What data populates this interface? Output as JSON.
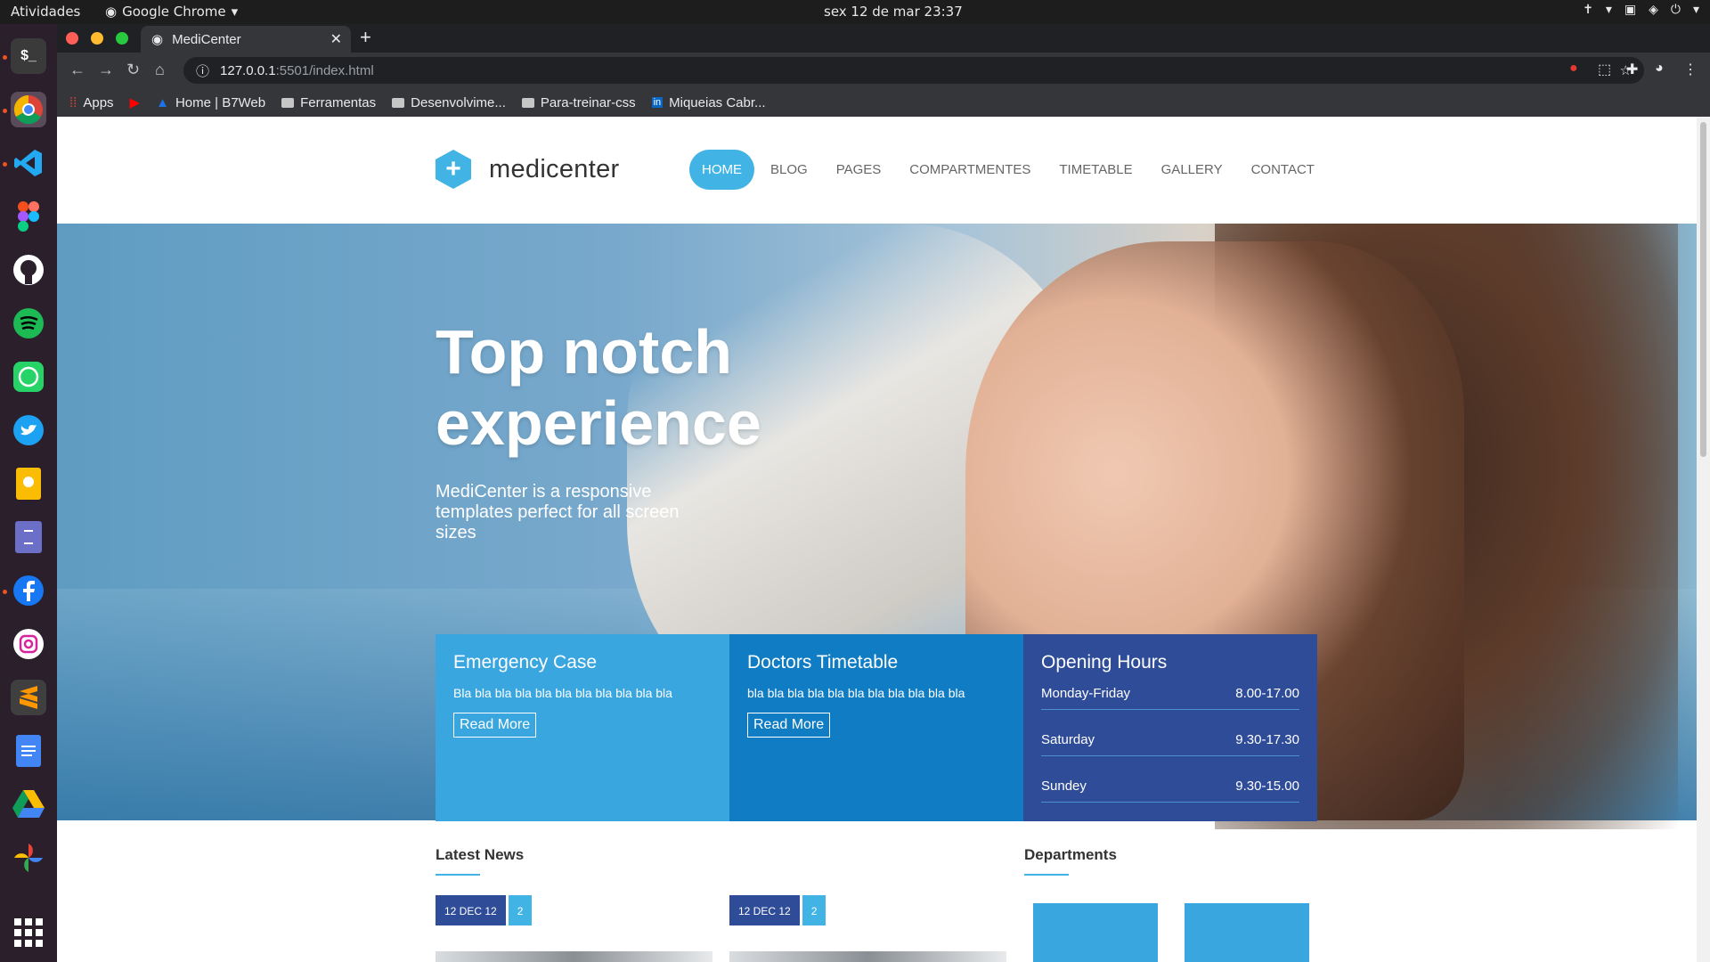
{
  "system": {
    "activities": "Atividades",
    "app_name": "Google Chrome",
    "clock": "sex 12 de mar  23:37"
  },
  "browser": {
    "tab_title": "MediCenter",
    "url_host": "127.0.0.1",
    "url_path": ":5501/index.html",
    "bookmarks": [
      {
        "label": "Apps",
        "icon": "apps-grid-icon"
      },
      {
        "label": "",
        "icon": "youtube-icon"
      },
      {
        "label": "Home | B7Web",
        "icon": "b7web-icon"
      },
      {
        "label": "Ferramentas",
        "icon": "folder-icon"
      },
      {
        "label": "Desenvolvime...",
        "icon": "folder-icon"
      },
      {
        "label": "Para-treinar-css",
        "icon": "folder-icon"
      },
      {
        "label": "Miqueias Cabr...",
        "icon": "linkedin-icon"
      }
    ]
  },
  "site": {
    "logo_text": "medicenter",
    "nav": [
      "HOME",
      "BLOG",
      "PAGES",
      "COMPARTMENTES",
      "TIMETABLE",
      "GALLERY",
      "CONTACT"
    ],
    "hero_title": "Top notch experience",
    "hero_lead": "MediCenter is a responsive templates perfect for all screen sizes",
    "cards": {
      "emergency": {
        "title": "Emergency Case",
        "text": "Bla bla bla bla bla bla bla bla bla bla bla",
        "button": "Read More"
      },
      "doctors": {
        "title": "Doctors Timetable",
        "text": "bla bla bla bla bla bla bla bla bla bla bla",
        "button": "Read More"
      },
      "hours": {
        "title": "Opening Hours",
        "rows": [
          {
            "day": "Monday-Friday",
            "time": "8.00-17.00"
          },
          {
            "day": "Saturday",
            "time": "9.30-17.30"
          },
          {
            "day": "Sundey",
            "time": "9.30-15.00"
          }
        ]
      }
    },
    "latest_news": "Latest News",
    "news": [
      {
        "date": "12 DEC 12",
        "comments": "2"
      },
      {
        "date": "12 DEC 12",
        "comments": "2"
      }
    ],
    "departments": "Departments"
  },
  "colors": {
    "accent": "#42b3e5",
    "card1": "#3aa6df",
    "card2": "#0f7cc4",
    "card3": "#2f4c99"
  }
}
